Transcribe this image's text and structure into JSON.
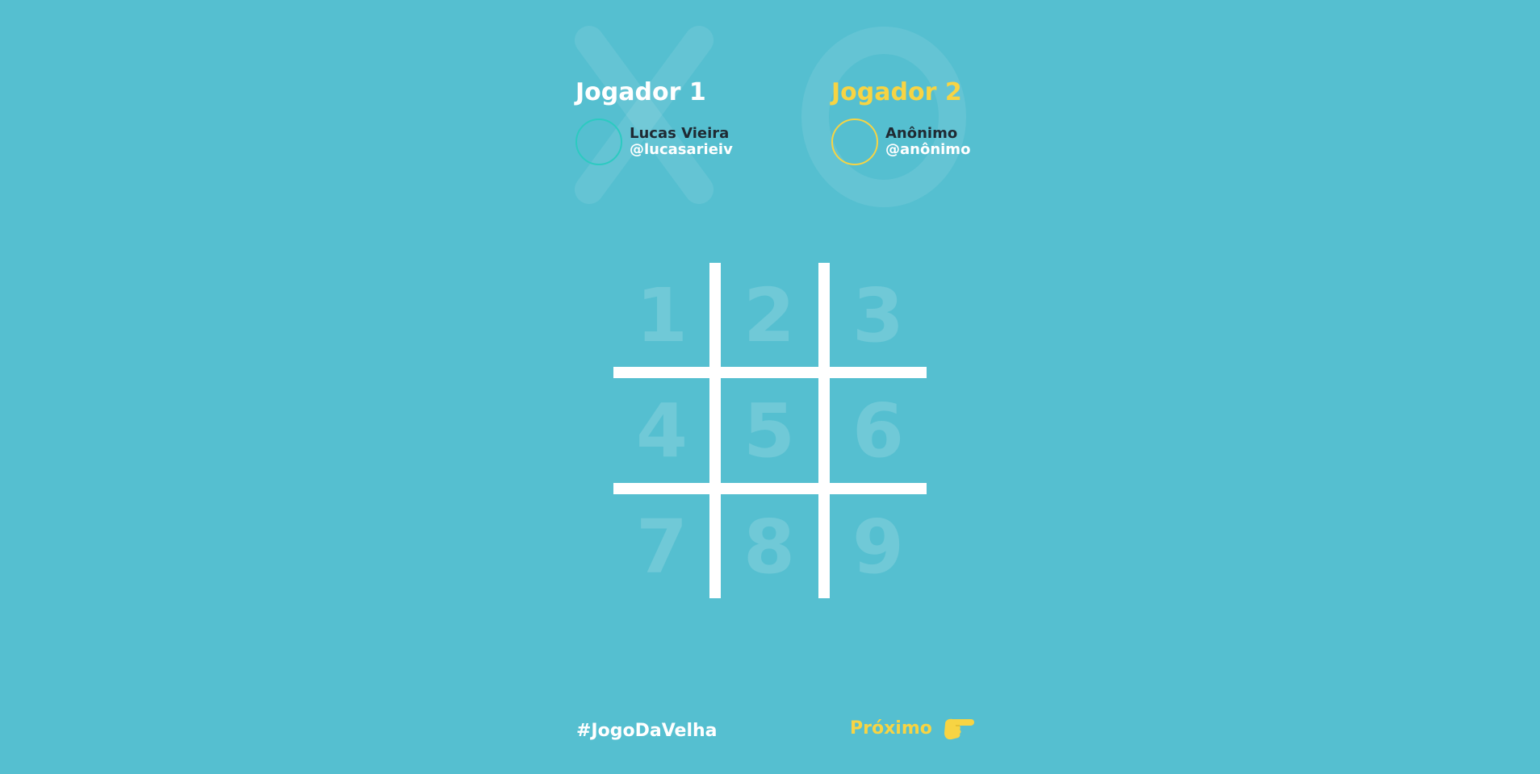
{
  "colors": {
    "background": "#55bfd0",
    "accent_yellow": "#f7d443",
    "player1_ring": "#2ccac1",
    "board_lines": "#ffffff",
    "name_text": "#1f2a33"
  },
  "watermarks": {
    "x_icon": "x-mark-icon",
    "o_icon": "o-mark-icon"
  },
  "players": [
    {
      "title": "Jogador 1",
      "name": "Lucas Vieira",
      "handle": "@lucasarieiv",
      "avatar_icon": "avatar-circle-icon"
    },
    {
      "title": "Jogador 2",
      "name": "Anônimo",
      "handle": "@anônimo",
      "avatar_icon": "avatar-circle-icon"
    }
  ],
  "board": {
    "cells": [
      "1",
      "2",
      "3",
      "4",
      "5",
      "6",
      "7",
      "8",
      "9"
    ]
  },
  "footer": {
    "hashtag": "#JogoDaVelha",
    "next_label": "Próximo",
    "next_icon": "pointing-hand-icon"
  }
}
